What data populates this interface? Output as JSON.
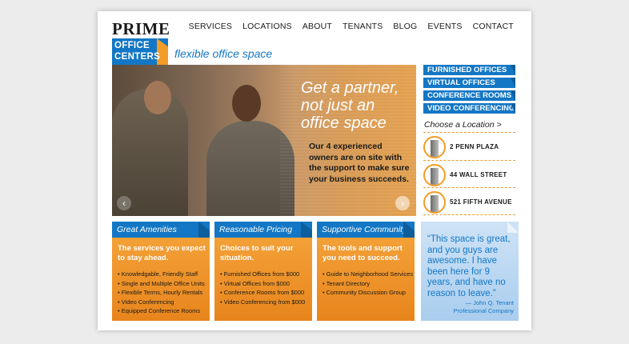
{
  "logo": {
    "prime": "PRIME",
    "line1": "OFFICE",
    "line2": "CENTERS",
    "tagline": "flexible office space"
  },
  "nav": [
    "SERVICES",
    "LOCATIONS",
    "ABOUT",
    "TENANTS",
    "BLOG",
    "EVENTS",
    "CONTACT"
  ],
  "hero": {
    "headline_line1": "Get a partner,",
    "headline_line2": "not just an",
    "headline_line3": "office space",
    "body": "Our 4 experienced owners are on site with the support to make sure your business succeeds."
  },
  "services_tabs": [
    "FURNISHED OFFICES",
    "VIRTUAL OFFICES",
    "CONFERENCE ROOMS",
    "VIDEO CONFERENCING"
  ],
  "choose_location": "Choose a Location >",
  "locations": [
    "2 PENN PLAZA",
    "44 WALL STREET",
    "521 FIFTH AVENUE"
  ],
  "columns": [
    {
      "title": "Great Amenities",
      "intro": "The services you expect to stay ahead.",
      "items": [
        "Knowledgable, Friendly Staff",
        "Single and Multiple Office Units",
        "Flexible Terms, Hourly Rentals",
        "Video Conferencing",
        "Equipped Conference Rooms"
      ]
    },
    {
      "title": "Reasonable Pricing",
      "intro": "Choices to suit your situation.",
      "items": [
        "Furnished Offices from $000",
        "Virtual Offices from $000",
        "Conference Rooms from $000",
        "Video Conferencing from $000"
      ]
    },
    {
      "title": "Supportive Community",
      "intro": "The tools and support you need to succeed.",
      "items": [
        "Guide to Neighborhood Services",
        "Tenant Directory",
        "Community Discussion Group"
      ]
    }
  ],
  "testimonial": {
    "quote": "“This space is great, and you guys are awesome. I have been here for 9 years, and have no reason to leave.”",
    "author": "— John Q. Tenant",
    "company": "Professional Company"
  },
  "colors": {
    "blue": "#1377c5",
    "orange": "#f39c27",
    "light_blue": "#cfe3f6"
  }
}
